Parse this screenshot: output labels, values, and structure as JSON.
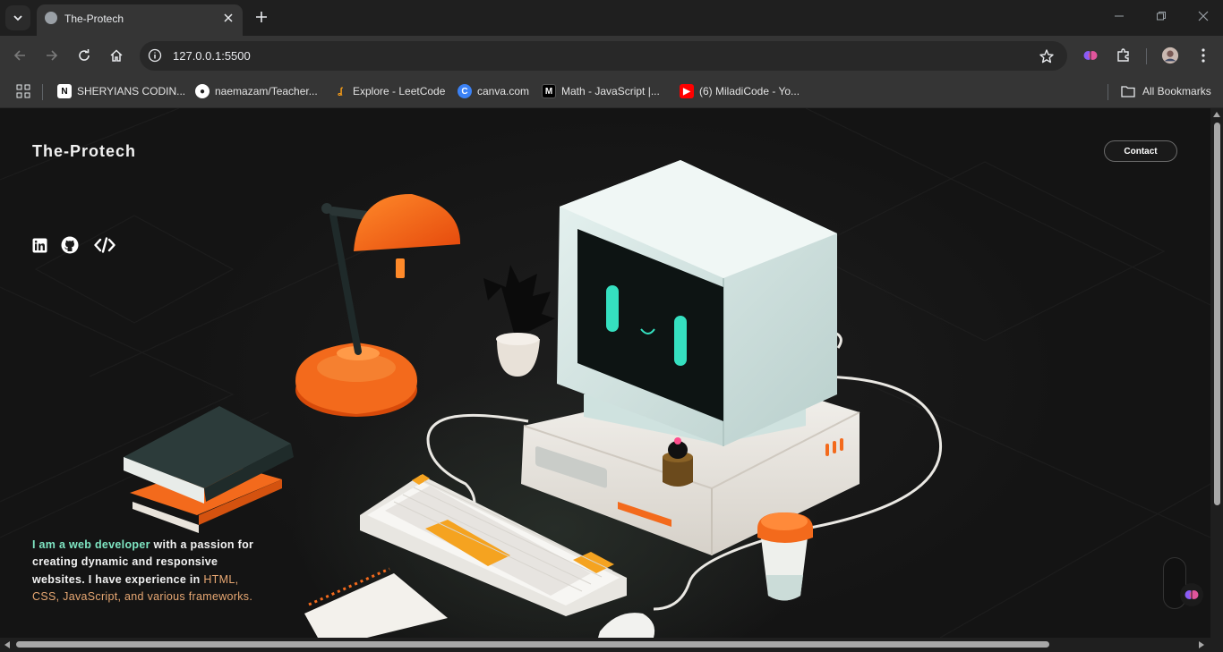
{
  "browser": {
    "tab_title": "The-Protech",
    "url": "127.0.0.1:5500",
    "bookmarks": [
      {
        "label": "SHERYIANS CODIN...",
        "icon": "notion-icon"
      },
      {
        "label": "naemazam/Teacher...",
        "icon": "github-icon"
      },
      {
        "label": "Explore - LeetCode",
        "icon": "leetcode-icon"
      },
      {
        "label": "canva.com",
        "icon": "canva-icon"
      },
      {
        "label": "Math - JavaScript |...",
        "icon": "mdn-icon"
      },
      {
        "label": "(6) MiladiCode - Yo...",
        "icon": "youtube-icon"
      }
    ],
    "all_bookmarks": "All Bookmarks"
  },
  "page": {
    "brand": "The-Protech",
    "contact_label": "Contact",
    "social": [
      "linkedin-icon",
      "github-icon",
      "code-icon"
    ],
    "intro": {
      "part1": "I am a web developer",
      "part2": " with a passion for creating dynamic and responsive websites. I have experience in ",
      "part3": "HTML, CSS, JavaScript, and various frameworks."
    }
  },
  "colors": {
    "accent_orange": "#f26b1d",
    "accent_green": "#7fe6c3",
    "screen_glow": "#35e0c0"
  }
}
